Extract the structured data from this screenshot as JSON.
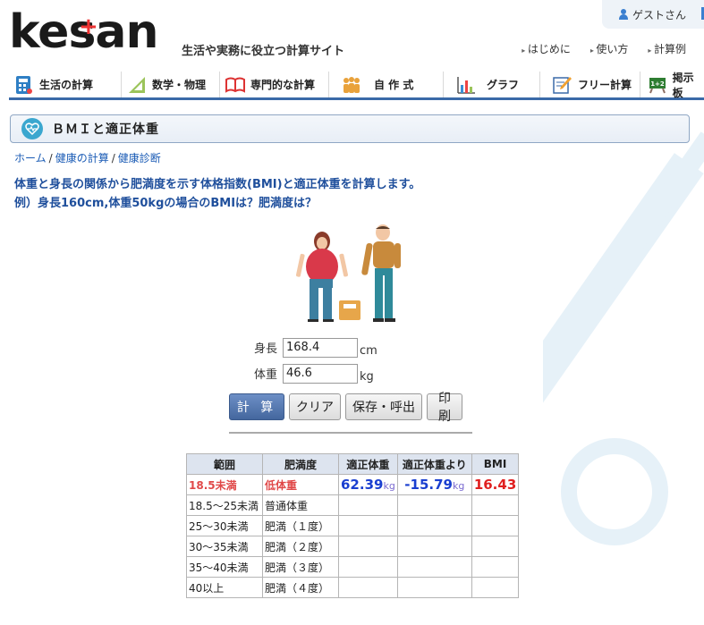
{
  "header": {
    "logo_text": "kesan",
    "logo_cross": "+",
    "tagline": "生活や実務に役立つ計算サイト",
    "guest": "ゲストさん",
    "links": [
      "はじめに",
      "使い方",
      "計算例"
    ]
  },
  "nav": [
    {
      "label": "生活の計算",
      "icon": "calculator-icon"
    },
    {
      "label": "数学・物理",
      "icon": "ruler-icon"
    },
    {
      "label": "専門的な計算",
      "icon": "book-icon"
    },
    {
      "label": "自 作 式",
      "icon": "people-icon"
    },
    {
      "label": "グラフ",
      "icon": "bar-chart-icon"
    },
    {
      "label": "フリー計算",
      "icon": "pencil-icon"
    },
    {
      "label": "掲示板",
      "icon": "board-icon"
    }
  ],
  "title": "ＢＭＩと適正体重",
  "breadcrumb": [
    "ホーム",
    "健康の計算",
    "健康診断"
  ],
  "breadcrumb_sep": "/",
  "description": {
    "line1": "体重と身長の関係から肥満度を示す体格指数(BMI)と適正体重を計算します。",
    "line2": "例）身長160cm,体重50kgの場合のBMIは？肥満度は？"
  },
  "form": {
    "height_label": "身長",
    "height_value": "168.4",
    "height_unit": "cm",
    "weight_label": "体重",
    "weight_value": "46.6",
    "weight_unit": "kg"
  },
  "buttons": {
    "calc": "計 算",
    "clear": "クリア",
    "save": "保存・呼出",
    "print": "印刷"
  },
  "table": {
    "headers": [
      "範囲",
      "肥満度",
      "適正体重",
      "適正体重より",
      "BMI"
    ],
    "rows": [
      {
        "range": "18.5未満",
        "level": "低体重"
      },
      {
        "range": "18.5～25未満",
        "level": "普通体重"
      },
      {
        "range": "25～30未満",
        "level": "肥満（１度）"
      },
      {
        "range": "30～35未満",
        "level": "肥満（２度）"
      },
      {
        "range": "35～40未満",
        "level": "肥満（３度）"
      },
      {
        "range": "40以上",
        "level": "肥満（４度）"
      }
    ],
    "result": {
      "ideal_weight": "62.39",
      "diff": "-15.79",
      "unit": "kg",
      "bmi": "16.43"
    }
  },
  "colors": {
    "accent": "#3a6aa8",
    "highlight": "#e04848",
    "link": "#1a5bb5"
  }
}
